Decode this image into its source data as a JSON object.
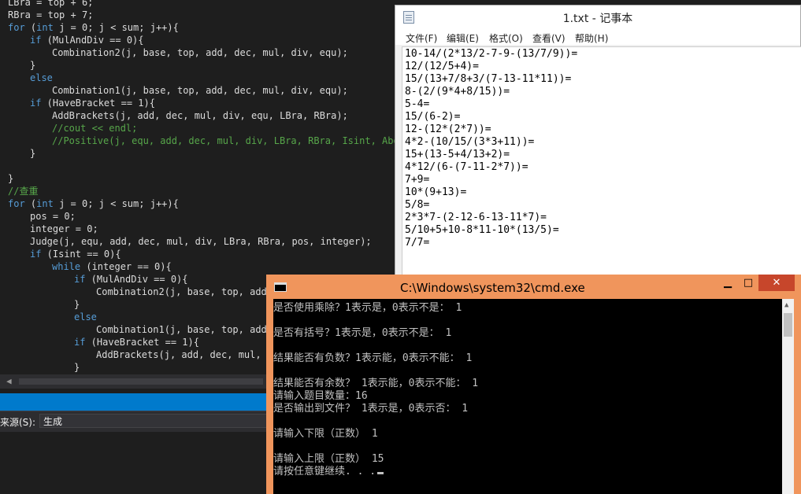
{
  "ide": {
    "code_lines": [
      {
        "text": "LBra = top + 6;",
        "indent": 0,
        "kind": "code"
      },
      {
        "text": "RBra = top + 7;",
        "indent": 0,
        "kind": "code"
      },
      {
        "text": "for (int j = 0; j < sum; j++){",
        "indent": 0,
        "kind": "code"
      },
      {
        "text": "if (MulAndDiv == 0){",
        "indent": 1,
        "kind": "code"
      },
      {
        "text": "Combination2(j, base, top, add, dec, mul, div, equ);",
        "indent": 2,
        "kind": "code"
      },
      {
        "text": "}",
        "indent": 1,
        "kind": "code"
      },
      {
        "text": "else",
        "indent": 1,
        "kind": "code"
      },
      {
        "text": "Combination1(j, base, top, add, dec, mul, div, equ);",
        "indent": 2,
        "kind": "code"
      },
      {
        "text": "if (HaveBracket == 1){",
        "indent": 1,
        "kind": "code"
      },
      {
        "text": "AddBrackets(j, add, dec, mul, div, equ, LBra, RBra);",
        "indent": 2,
        "kind": "code"
      },
      {
        "text": "//cout << endl;",
        "indent": 2,
        "kind": "comment"
      },
      {
        "text": "//Positive(j, equ, add, dec, mul, div, LBra, RBra, Isint, Abov",
        "indent": 2,
        "kind": "comment"
      },
      {
        "text": "}",
        "indent": 1,
        "kind": "code"
      },
      {
        "text": "",
        "indent": 0,
        "kind": "code"
      },
      {
        "text": "}",
        "indent": 0,
        "kind": "code"
      },
      {
        "text": "//查重",
        "indent": 0,
        "kind": "comment"
      },
      {
        "text": "for (int j = 0; j < sum; j++){",
        "indent": 0,
        "kind": "code"
      },
      {
        "text": "pos = 0;",
        "indent": 1,
        "kind": "code"
      },
      {
        "text": "integer = 0;",
        "indent": 1,
        "kind": "code"
      },
      {
        "text": "Judge(j, equ, add, dec, mul, div, LBra, RBra, pos, integer);",
        "indent": 1,
        "kind": "code"
      },
      {
        "text": "if (Isint == 0){",
        "indent": 1,
        "kind": "code"
      },
      {
        "text": "while (integer == 0){",
        "indent": 2,
        "kind": "code"
      },
      {
        "text": "if (MulAndDiv == 0){",
        "indent": 3,
        "kind": "code"
      },
      {
        "text": "Combination2(j, base, top, add,",
        "indent": 4,
        "kind": "code"
      },
      {
        "text": "}",
        "indent": 3,
        "kind": "code"
      },
      {
        "text": "else",
        "indent": 3,
        "kind": "code"
      },
      {
        "text": "Combination1(j, base, top, add,",
        "indent": 4,
        "kind": "code"
      },
      {
        "text": "if (HaveBracket == 1){",
        "indent": 3,
        "kind": "code"
      },
      {
        "text": "AddBrackets(j, add, dec, mul, d",
        "indent": 4,
        "kind": "code"
      },
      {
        "text": "}",
        "indent": 3,
        "kind": "code"
      }
    ],
    "keywords": [
      "for",
      "int",
      "if",
      "else",
      "while"
    ],
    "output_source_label": "来源(S):",
    "output_source_value": "生成"
  },
  "notepad": {
    "title": "1.txt - 记事本",
    "menu": [
      "文件(F)",
      "编辑(E)",
      "格式(O)",
      "查看(V)",
      "帮助(H)"
    ],
    "lines": [
      "10-14/(2*13/2-7-9-(13/7/9))=",
      "12/(12/5+4)=",
      "15/(13+7/8+3/(7-13-11*11))=",
      "8-(2/(9*4+8/15))=",
      "5-4=",
      "15/(6-2)=",
      "12-(12*(2*7))=",
      "4*2-(10/15/(3*3+11))=",
      "15+(13-5+4/13+2)=",
      "4*12/(6-(7-11-2*7))=",
      "7+9=",
      "10*(9+13)=",
      "5/8=",
      "2*3*7-(2-12-6-13-11*7)=",
      "5/10+5+10-8*11-10*(13/5)=",
      "7/7="
    ]
  },
  "cmd": {
    "title": "C:\\Windows\\system32\\cmd.exe",
    "min_glyph": "▁",
    "max_glyph": "□",
    "close_glyph": "✕",
    "lines": [
      "是否使用乘除？1表示是，0表示不是： 1",
      "",
      "是否有括号？1表示是，0表示不是： 1",
      "",
      "结果能否有负数？1表示能，0表示不能： 1",
      "",
      "结果能否有余数？ 1表示能，0表示不能： 1",
      "请输入题目数量：16",
      "是否输出到文件？ 1表示是，0表示否： 1",
      "",
      "请输入下限（正数） 1",
      "",
      "请输入上限（正数） 15",
      "请按任意键继续. . ."
    ]
  },
  "colors": {
    "ide_bg": "#1e1e1e",
    "keyword": "#569cd6",
    "comment": "#57a64a",
    "status_blue": "#007acc",
    "cmd_frame": "#f0955c",
    "cmd_close": "#c7462b"
  },
  "icons": {
    "notepad": "notepad-app-icon",
    "cmd": "cmd-app-icon"
  }
}
